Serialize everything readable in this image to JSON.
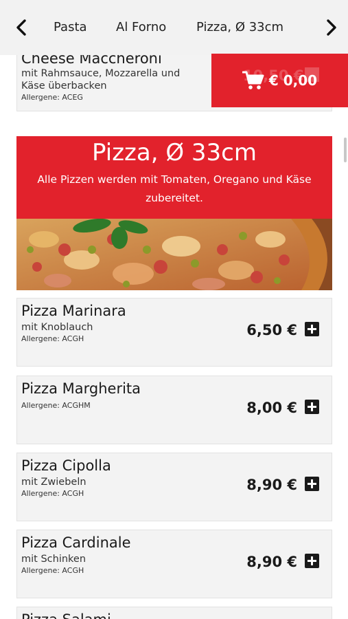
{
  "nav": {
    "categories": [
      "Pasta",
      "Al Forno",
      "Pizza, Ø 33cm"
    ]
  },
  "previous_item": {
    "name": "Cheese Maccheroni",
    "description": "mit Rahmsauce, Mozzarella und Käse überbacken",
    "allergens": "Allergene: ACEG"
  },
  "cart": {
    "total": "€ 0,00",
    "hidden_price": "10,50 €"
  },
  "section": {
    "title": "Pizza, Ø 33cm",
    "subtitle": "Alle Pizzen werden mit Tomaten, Oregano und Käse zubereitet."
  },
  "items": [
    {
      "name": "Pizza Marinara",
      "description": "mit Knoblauch",
      "allergens": "Allergene: ACGH",
      "price": "6,50 €"
    },
    {
      "name": "Pizza Margherita",
      "description": "",
      "allergens": "Allergene: ACGHM",
      "price": "8,00 €"
    },
    {
      "name": "Pizza Cipolla",
      "description": "mit Zwiebeln",
      "allergens": "Allergene: ACGH",
      "price": "8,90 €"
    },
    {
      "name": "Pizza Cardinale",
      "description": "mit Schinken",
      "allergens": "Allergene: ACGH",
      "price": "8,90 €"
    },
    {
      "name": "Pizza Salami",
      "description": "",
      "allergens": "",
      "price": ""
    }
  ],
  "icons": {
    "back": "chevron-left-icon",
    "forward": "chevron-right-icon",
    "cart": "shopping-cart-icon",
    "add": "plus-square-icon"
  },
  "colors": {
    "accent": "#e2222c",
    "nav_background": "#f2f2f2",
    "card_background": "#f3f3f3"
  }
}
